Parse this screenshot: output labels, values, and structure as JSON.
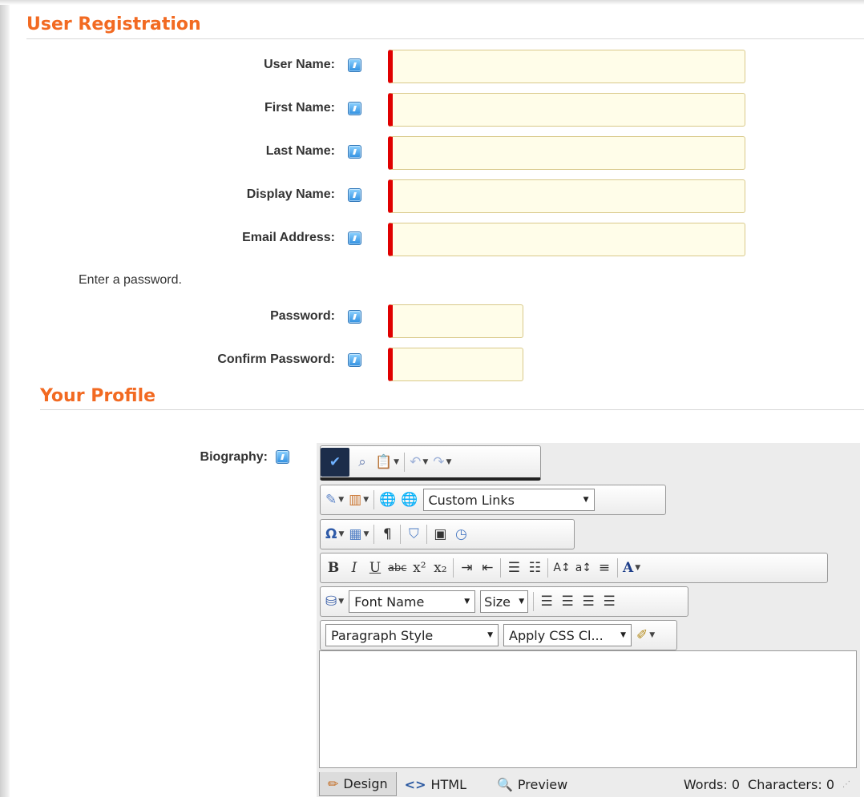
{
  "registration": {
    "title": "User Registration",
    "fields": [
      {
        "label": "User Name:",
        "value": ""
      },
      {
        "label": "First Name:",
        "value": ""
      },
      {
        "label": "Last Name:",
        "value": ""
      },
      {
        "label": "Display Name:",
        "value": ""
      },
      {
        "label": "Email Address:",
        "value": ""
      }
    ],
    "password_hint": "Enter a password.",
    "password_fields": [
      {
        "label": "Password:",
        "value": ""
      },
      {
        "label": "Confirm Password:",
        "value": ""
      }
    ]
  },
  "profile": {
    "title": "Your Profile",
    "biography_label": "Biography:"
  },
  "editor": {
    "links_dropdown": "Custom Links",
    "font_name_dropdown": "Font Name",
    "size_dropdown": "Size",
    "paragraph_style_dropdown": "Paragraph Style",
    "css_class_dropdown": "Apply CSS Cl...",
    "modes": {
      "design": "Design",
      "html": "HTML",
      "preview": "Preview"
    },
    "words": "Words: 0",
    "characters": "Characters: 0"
  },
  "colors": {
    "accent": "#f26a22",
    "required_marker": "#e00000",
    "field_background": "#fffde9"
  }
}
